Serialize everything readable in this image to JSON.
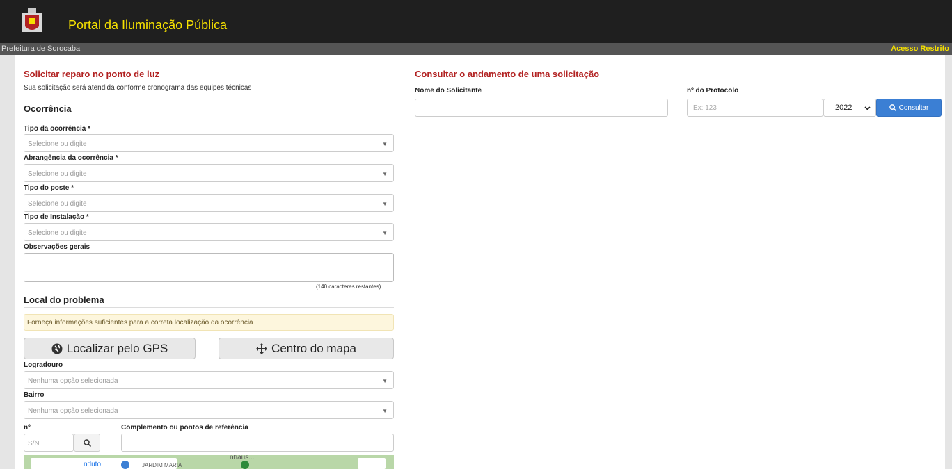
{
  "header": {
    "title": "Portal da Iluminação Pública",
    "org": "Prefeitura de Sorocaba",
    "restricted": "Acesso Restrito"
  },
  "request": {
    "title": "Solicitar reparo no ponto de luz",
    "subtitle": "Sua solicitação será atendida conforme cronograma das equipes técnicas",
    "occurrence_heading": "Ocorrência",
    "fields": [
      {
        "label": "Tipo da ocorrência *",
        "placeholder": "Selecione ou digite"
      },
      {
        "label": "Abrangência da ocorrência *",
        "placeholder": "Selecione ou digite"
      },
      {
        "label": "Tipo do poste *",
        "placeholder": "Selecione ou digite"
      },
      {
        "label": "Tipo de Instalação *",
        "placeholder": "Selecione ou digite"
      }
    ],
    "notes_label": "Observações gerais",
    "notes_counter": "(140 caracteres restantes)",
    "location_heading": "Local do problema",
    "location_alert": "Forneça informações suficientes para a correta localização da ocorrência",
    "gps_button": "Localizar pelo GPS",
    "center_button": "Centro do mapa",
    "street_label": "Logradouro",
    "street_placeholder": "Nenhuma opção selecionada",
    "district_label": "Bairro",
    "district_placeholder": "Nenhuma opção selecionada",
    "number_label": "nº",
    "number_placeholder": "S/N",
    "complement_label": "Complemento ou pontos de referência",
    "map_labels": [
      "nduto",
      "JARDIM MARIA",
      "nhaus..."
    ]
  },
  "query": {
    "title": "Consultar o andamento de uma solicitação",
    "name_label": "Nome do Solicitante",
    "protocol_label": "nº do Protocolo",
    "protocol_placeholder": "Ex: 123",
    "year_value": "2022",
    "consult_button": "Consultar"
  },
  "colors": {
    "header_bg": "#1f1f1f",
    "title_yellow": "#f5e000",
    "section_red": "#b22222",
    "primary_blue": "#3b7fd4",
    "alert_bg": "#fdf6dd"
  }
}
